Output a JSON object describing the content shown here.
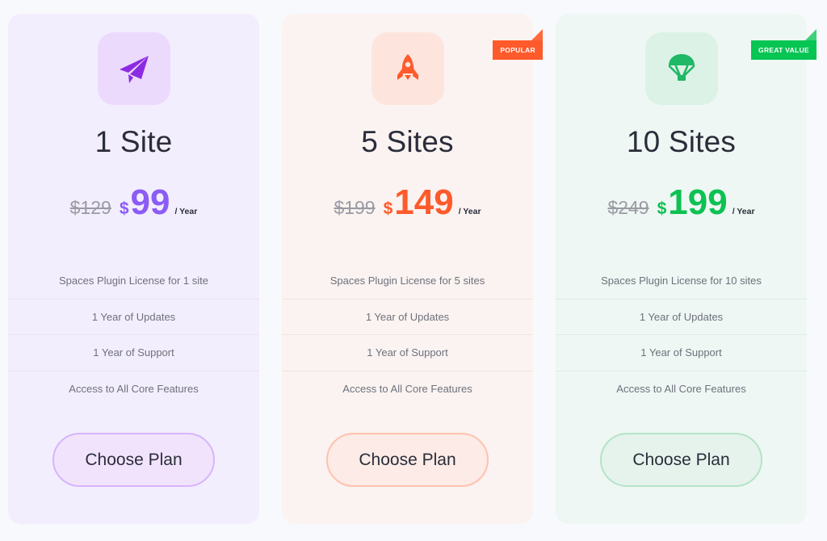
{
  "plans": [
    {
      "icon": "paper-plane-icon",
      "badge": null,
      "title": "1 Site",
      "old_price": "$129",
      "currency": "$",
      "price": "99",
      "period": "/ Year",
      "accent": "#8b5cf6",
      "features": [
        "Spaces Plugin License for 1 site",
        "1 Year of Updates",
        "1 Year of Support",
        "Access to All Core Features"
      ],
      "button_label": "Choose Plan"
    },
    {
      "icon": "rocket-icon",
      "badge": "POPULAR",
      "title": "5 Sites",
      "old_price": "$199",
      "currency": "$",
      "price": "149",
      "period": "/ Year",
      "accent": "#ff5a2b",
      "features": [
        "Spaces Plugin License for 5 sites",
        "1 Year of Updates",
        "1 Year of Support",
        "Access to All Core Features"
      ],
      "button_label": "Choose Plan"
    },
    {
      "icon": "parachute-icon",
      "badge": "GREAT VALUE",
      "title": "10 Sites",
      "old_price": "$249",
      "currency": "$",
      "price": "199",
      "period": "/ Year",
      "accent": "#0dc152",
      "features": [
        "Spaces Plugin License for 10 sites",
        "1 Year of Updates",
        "1 Year of Support",
        "Access to All Core Features"
      ],
      "button_label": "Choose Plan"
    }
  ]
}
